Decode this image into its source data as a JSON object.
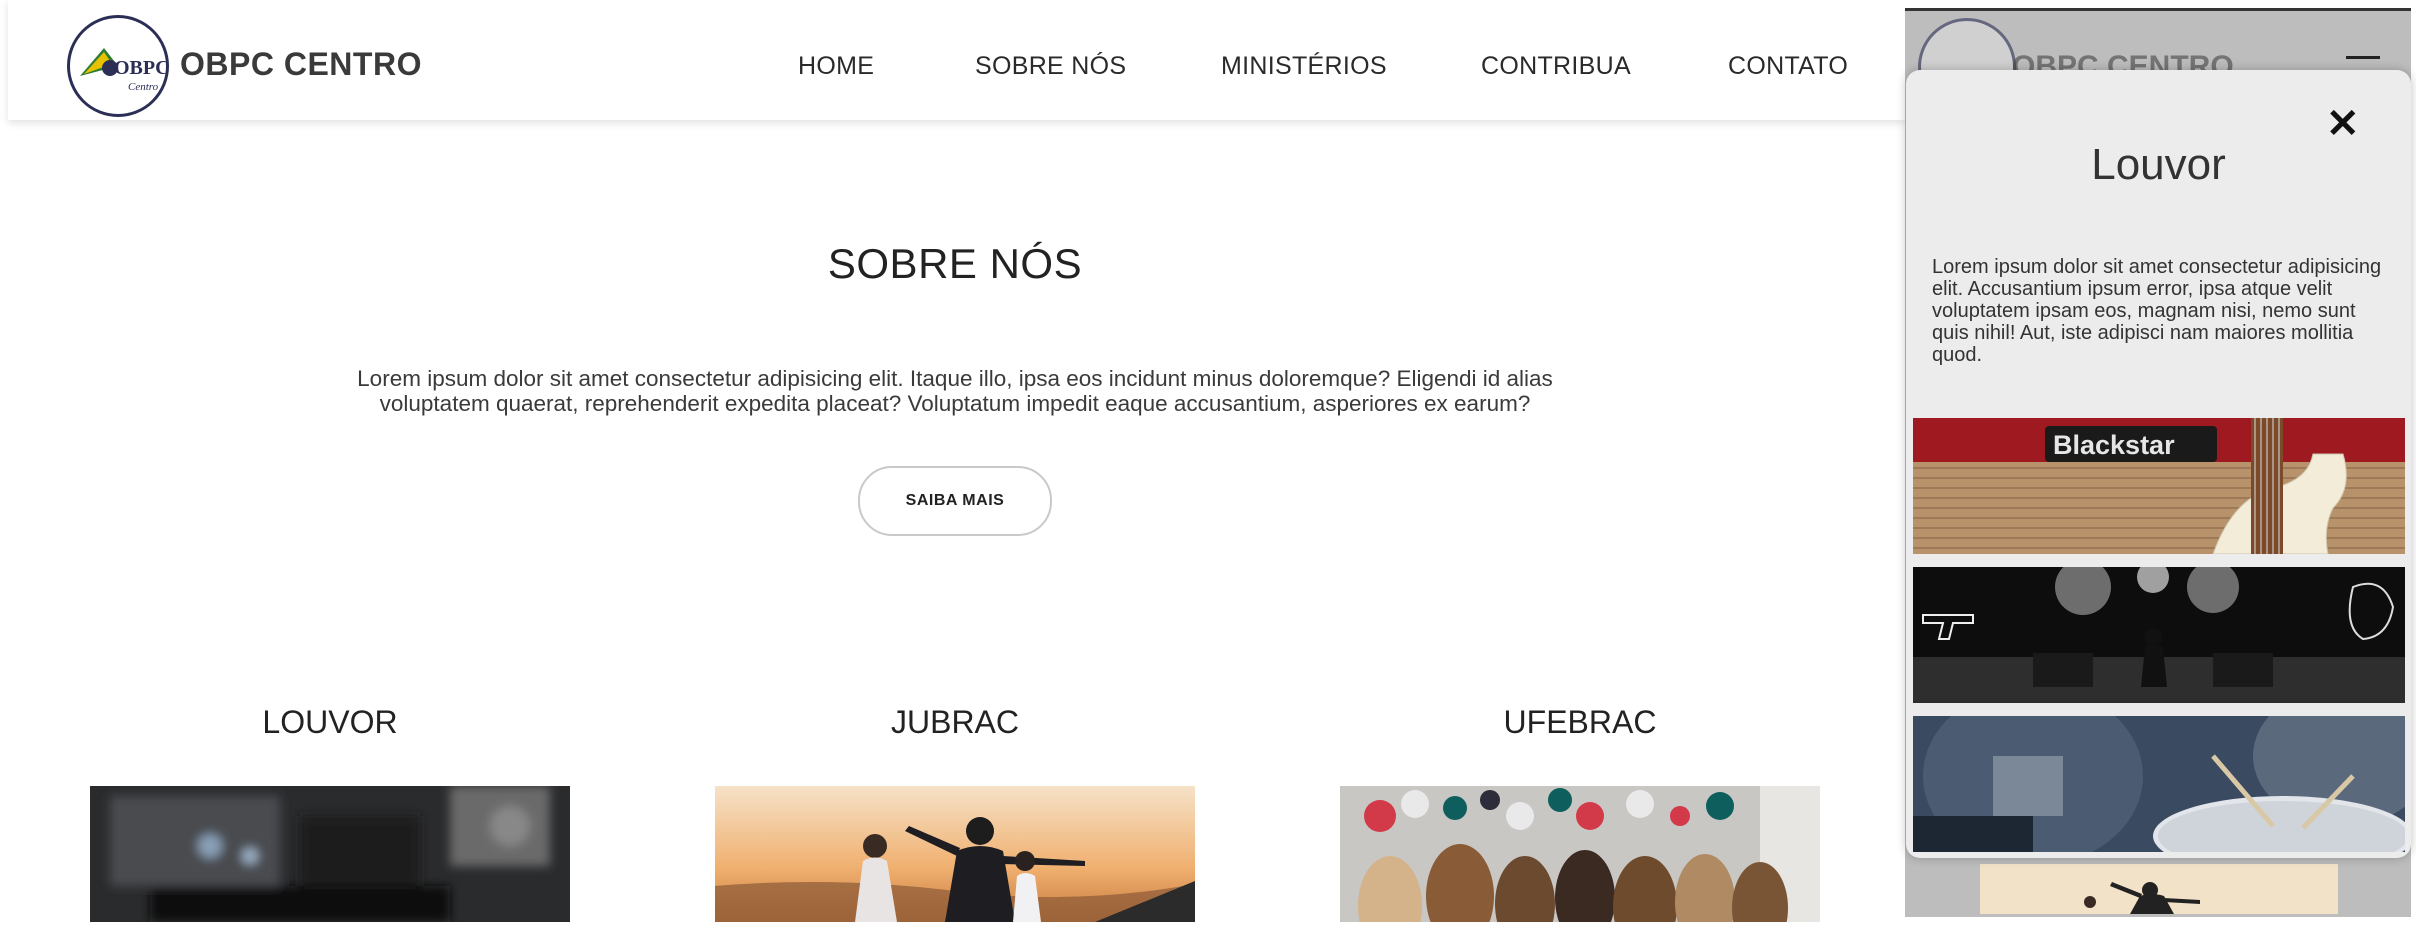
{
  "header": {
    "brand": "OBPC CENTRO",
    "logo_text": "OBPC",
    "logo_subtext": "Centro",
    "nav": [
      "HOME",
      "SOBRE NÓS",
      "MINISTÉRIOS",
      "CONTRIBUA",
      "CONTATO"
    ]
  },
  "about": {
    "title": "SOBRE NÓS",
    "text_line1": "Lorem ipsum dolor sit amet consectetur adipisicing elit. Itaque illo, ipsa eos incidunt minus doloremque? Eligendi id alias",
    "text_line2": "voluptatem quaerat, reprehenderit expedita placeat? Voluptatum impedit eaque accusantium, asperiores ex earum?",
    "button": "SAIBA MAIS"
  },
  "cards": [
    {
      "title": "LOUVOR"
    },
    {
      "title": "JUBRAC"
    },
    {
      "title": "UFEBRAC"
    }
  ],
  "panel": {
    "close": "✕",
    "title": "Louvor",
    "text": "Lorem ipsum dolor sit amet consectetur adipisicing elit. Accusantium ipsum error, ipsa atque velit voluptatem ipsam eos, magnam nisi, nemo sunt quis nihil! Aut, iste adipisci nam maiores mollitia quod.",
    "amp_brand": "Blackstar"
  },
  "colors": {
    "accent_red": "#b31d22",
    "logo_navy": "#2b2f55",
    "logo_green": "#2e7d32",
    "logo_yellow": "#e6c200"
  }
}
